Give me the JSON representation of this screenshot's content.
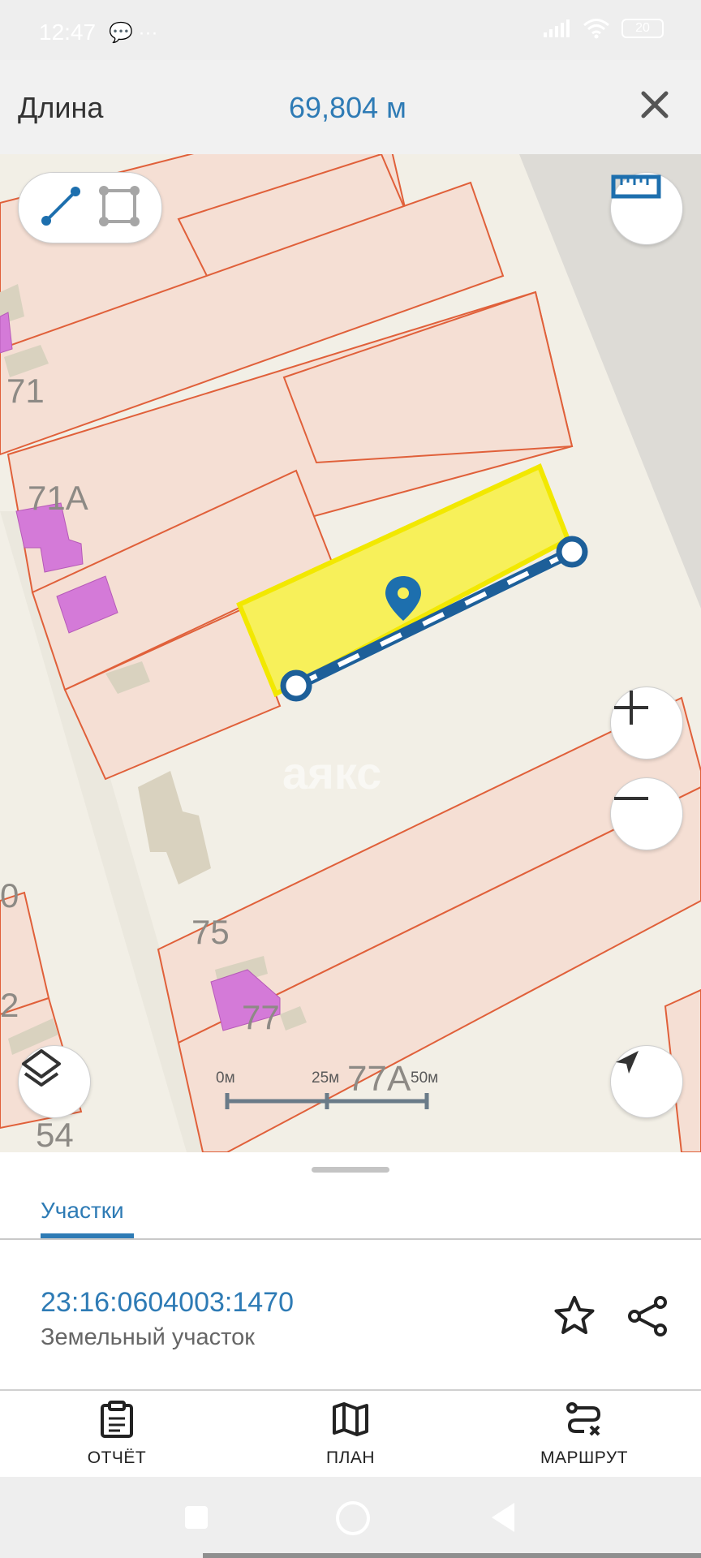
{
  "status_bar": {
    "time": "12:47",
    "left_icons": "💬 ···",
    "battery": "20"
  },
  "measure": {
    "label": "Длина",
    "value": "69,804 м"
  },
  "map": {
    "labels": [
      "71",
      "71А",
      "75",
      "77",
      "77А",
      "54",
      "2",
      "0"
    ],
    "watermark": "аякс",
    "scale": {
      "zero": "0м",
      "mid": "25м",
      "max": "50м"
    }
  },
  "sheet": {
    "tab": "Участки",
    "parcel": {
      "id": "23:16:0604003:1470",
      "type": "Земельный участок"
    },
    "actions": {
      "report": "ОТЧЁТ",
      "plan": "ПЛАН",
      "route": "МАРШРУТ"
    }
  },
  "colors": {
    "accent": "#2e7bb5",
    "parcel_fill": "#f5dfd4",
    "parcel_stroke": "#e0603a",
    "selection": "#f7f05a",
    "building": "#d9d2bf",
    "purple": "#d47ad8"
  },
  "icons": {
    "close": "close-icon",
    "line_tool": "line-tool-icon",
    "polygon_tool": "polygon-tool-icon",
    "ruler": "ruler-icon",
    "zoom_in": "plus-icon",
    "zoom_out": "minus-icon",
    "layers": "layers-icon",
    "location": "navigation-arrow-icon",
    "star": "star-icon",
    "share": "share-icon",
    "report": "clipboard-icon",
    "plan": "map-icon",
    "route": "route-icon"
  }
}
